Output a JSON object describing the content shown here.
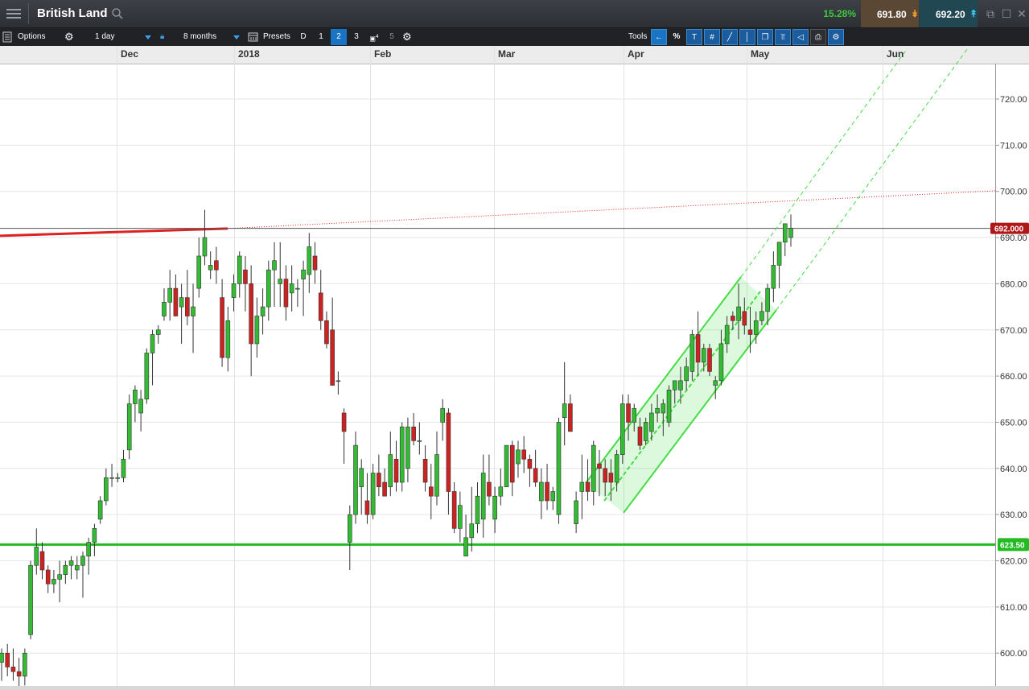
{
  "header": {
    "menu_icon": "hamburger-menu-icon",
    "title": "British Land",
    "search_icon": "search-icon",
    "change_pct": "15.28%",
    "sell_price": "691.80",
    "buy_price": "692.20",
    "colors": {
      "change_pct": "#3ec83e",
      "sell_bg": "#5a4834",
      "buy_bg": "#214852"
    }
  },
  "toolbar": {
    "options_label": "Options",
    "interval": "1 day",
    "range": "8 months",
    "presets_label": "Presets",
    "preset_buttons": [
      "D",
      "1",
      "2",
      "3",
      "4",
      "5"
    ],
    "active_preset": "2",
    "tools_label": "Tools",
    "percent_label": "%"
  },
  "chart_data": {
    "type": "candlestick",
    "x_labels": [
      "Dec",
      "2018",
      "Feb",
      "Mar",
      "Apr",
      "May",
      "Jun"
    ],
    "y_ticks": [
      "600.00",
      "610.00",
      "620.00",
      "630.00",
      "640.00",
      "650.00",
      "660.00",
      "670.00",
      "680.00",
      "690.00",
      "700.00",
      "710.00",
      "720.00"
    ],
    "current_price_label": "692.000",
    "support_label": "623.50",
    "ylim": [
      596,
      730
    ],
    "colors": {
      "up": "#33bb33",
      "down": "#cc2222",
      "support": "#22bb22",
      "resistance": "#dd2222",
      "channel": "#44dd44",
      "price_marker": "#b01818"
    },
    "candles": [
      [
        598,
        601,
        594,
        600
      ],
      [
        600,
        602,
        595,
        597
      ],
      [
        597,
        601,
        594,
        596
      ],
      [
        596,
        599,
        592,
        595
      ],
      [
        595,
        601,
        593,
        600
      ],
      [
        604,
        620,
        603,
        619
      ],
      [
        619,
        627,
        617,
        623
      ],
      [
        622,
        624,
        616,
        618
      ],
      [
        618,
        619,
        613,
        615
      ],
      [
        615,
        618,
        613,
        616
      ],
      [
        616,
        620,
        611,
        617
      ],
      [
        617,
        620,
        615,
        619
      ],
      [
        619,
        621,
        616,
        620
      ],
      [
        618,
        621,
        616,
        619
      ],
      [
        619,
        622,
        612,
        621
      ],
      [
        621,
        625,
        617,
        624
      ],
      [
        624,
        628,
        621,
        627
      ],
      [
        629,
        634,
        628,
        633
      ],
      [
        633,
        640,
        632,
        638
      ],
      [
        638,
        641,
        636,
        638
      ],
      [
        638,
        639,
        637,
        638
      ],
      [
        638,
        644,
        637,
        642
      ],
      [
        644,
        656,
        642,
        654
      ],
      [
        654,
        658,
        650,
        657
      ],
      [
        652,
        657,
        648,
        655
      ],
      [
        655,
        666,
        654,
        665
      ],
      [
        665,
        670,
        658,
        669
      ],
      [
        669,
        671,
        667,
        670
      ],
      [
        673,
        679,
        672,
        676
      ],
      [
        676,
        683,
        672,
        679
      ],
      [
        679,
        682,
        674,
        673
      ],
      [
        675,
        680,
        667,
        677
      ],
      [
        677,
        683,
        671,
        673
      ],
      [
        673,
        680,
        665,
        675
      ],
      [
        679,
        690,
        677,
        686
      ],
      [
        686,
        696,
        684,
        690
      ],
      [
        683,
        687,
        681,
        684
      ],
      [
        685,
        688,
        680,
        683
      ],
      [
        677,
        681,
        662,
        664
      ],
      [
        664,
        675,
        661,
        672
      ],
      [
        677,
        682,
        674,
        680
      ],
      [
        680,
        687,
        677,
        686
      ],
      [
        683,
        686,
        674,
        680
      ],
      [
        680,
        684,
        660,
        667
      ],
      [
        667,
        677,
        664,
        673
      ],
      [
        673,
        679,
        669,
        675
      ],
      [
        675,
        685,
        672,
        683
      ],
      [
        683,
        689,
        675,
        685
      ],
      [
        680,
        689,
        675,
        681
      ],
      [
        681,
        684,
        672,
        675
      ],
      [
        678,
        684,
        674,
        680
      ],
      [
        679,
        681,
        675,
        679
      ],
      [
        681,
        685,
        673,
        683
      ],
      [
        682,
        691,
        678,
        688
      ],
      [
        686,
        689,
        680,
        683
      ],
      [
        678,
        683,
        670,
        672
      ],
      [
        672,
        674,
        666,
        667
      ],
      [
        670,
        677,
        658,
        658
      ],
      [
        659,
        661,
        656,
        659
      ],
      [
        652,
        653,
        641,
        648
      ],
      [
        624,
        632,
        618,
        630
      ],
      [
        630,
        648,
        628,
        645
      ],
      [
        636,
        642,
        630,
        640
      ],
      [
        633,
        639,
        628,
        630
      ],
      [
        630,
        641,
        629,
        639
      ],
      [
        639,
        643,
        634,
        636
      ],
      [
        637,
        640,
        634,
        634
      ],
      [
        636,
        648,
        634,
        643
      ],
      [
        642,
        646,
        635,
        637
      ],
      [
        637,
        650,
        635,
        649
      ],
      [
        640,
        651,
        637,
        649
      ],
      [
        649,
        652,
        645,
        646
      ],
      [
        646,
        650,
        643,
        646
      ],
      [
        642,
        645,
        635,
        637
      ],
      [
        636,
        641,
        629,
        634
      ],
      [
        634,
        648,
        632,
        643
      ],
      [
        650,
        655,
        646,
        653
      ],
      [
        652,
        653,
        630,
        635
      ],
      [
        635,
        637,
        626,
        627
      ],
      [
        627,
        635,
        624,
        632
      ],
      [
        621,
        630,
        623,
        625
      ],
      [
        625,
        636,
        622,
        628
      ],
      [
        628,
        637,
        626,
        634
      ],
      [
        629,
        643,
        625,
        639
      ],
      [
        637,
        643,
        632,
        634
      ],
      [
        629,
        636,
        626,
        634
      ],
      [
        634,
        640,
        632,
        636
      ],
      [
        636,
        645,
        636,
        645
      ],
      [
        645,
        646,
        634,
        637
      ],
      [
        641,
        646,
        638,
        644
      ],
      [
        644,
        647,
        639,
        642
      ],
      [
        642,
        643,
        636,
        640
      ],
      [
        640,
        644,
        636,
        637
      ],
      [
        633,
        640,
        629,
        637
      ],
      [
        637,
        641,
        631,
        633
      ],
      [
        633,
        636,
        631,
        635
      ],
      [
        630,
        651,
        628,
        650
      ],
      [
        651,
        663,
        645,
        654
      ],
      [
        654,
        656,
        649,
        648
      ],
      [
        628,
        635,
        626,
        633
      ],
      [
        635,
        643,
        629,
        637
      ],
      [
        637,
        642,
        633,
        635
      ],
      [
        635,
        646,
        632,
        645
      ],
      [
        641,
        644,
        634,
        640
      ],
      [
        640,
        642,
        634,
        637
      ],
      [
        639,
        642,
        633,
        637
      ],
      [
        637,
        644,
        635,
        643
      ],
      [
        643,
        656,
        641,
        654
      ],
      [
        654,
        656,
        646,
        650
      ],
      [
        650,
        654,
        648,
        653
      ],
      [
        649,
        651,
        644,
        645
      ],
      [
        646,
        651,
        645,
        650
      ],
      [
        648,
        654,
        646,
        652
      ],
      [
        652,
        656,
        650,
        653
      ],
      [
        652,
        655,
        647,
        654
      ],
      [
        650,
        658,
        649,
        657
      ],
      [
        657,
        659,
        654,
        659
      ],
      [
        657,
        662,
        654,
        659
      ],
      [
        659,
        664,
        657,
        662
      ],
      [
        661,
        670,
        659,
        669
      ],
      [
        669,
        674,
        660,
        663
      ],
      [
        663,
        667,
        661,
        666
      ],
      [
        666,
        667,
        660,
        661
      ],
      [
        658,
        660,
        655,
        659
      ],
      [
        659,
        670,
        658,
        667
      ],
      [
        667,
        673,
        665,
        671
      ],
      [
        673,
        674,
        670,
        672
      ],
      [
        672,
        680,
        668,
        675
      ],
      [
        674,
        677,
        669,
        671
      ],
      [
        670,
        675,
        665,
        669
      ],
      [
        669,
        674,
        667,
        672
      ],
      [
        672,
        676,
        671,
        674
      ],
      [
        674,
        680,
        671,
        679
      ],
      [
        679,
        687,
        676,
        684
      ],
      [
        684,
        688,
        679,
        689
      ],
      [
        689,
        692,
        686,
        693
      ],
      [
        690,
        695,
        688,
        692
      ]
    ],
    "support_level": 623.5,
    "resistance_segment": {
      "from": 693,
      "to": 701
    }
  }
}
